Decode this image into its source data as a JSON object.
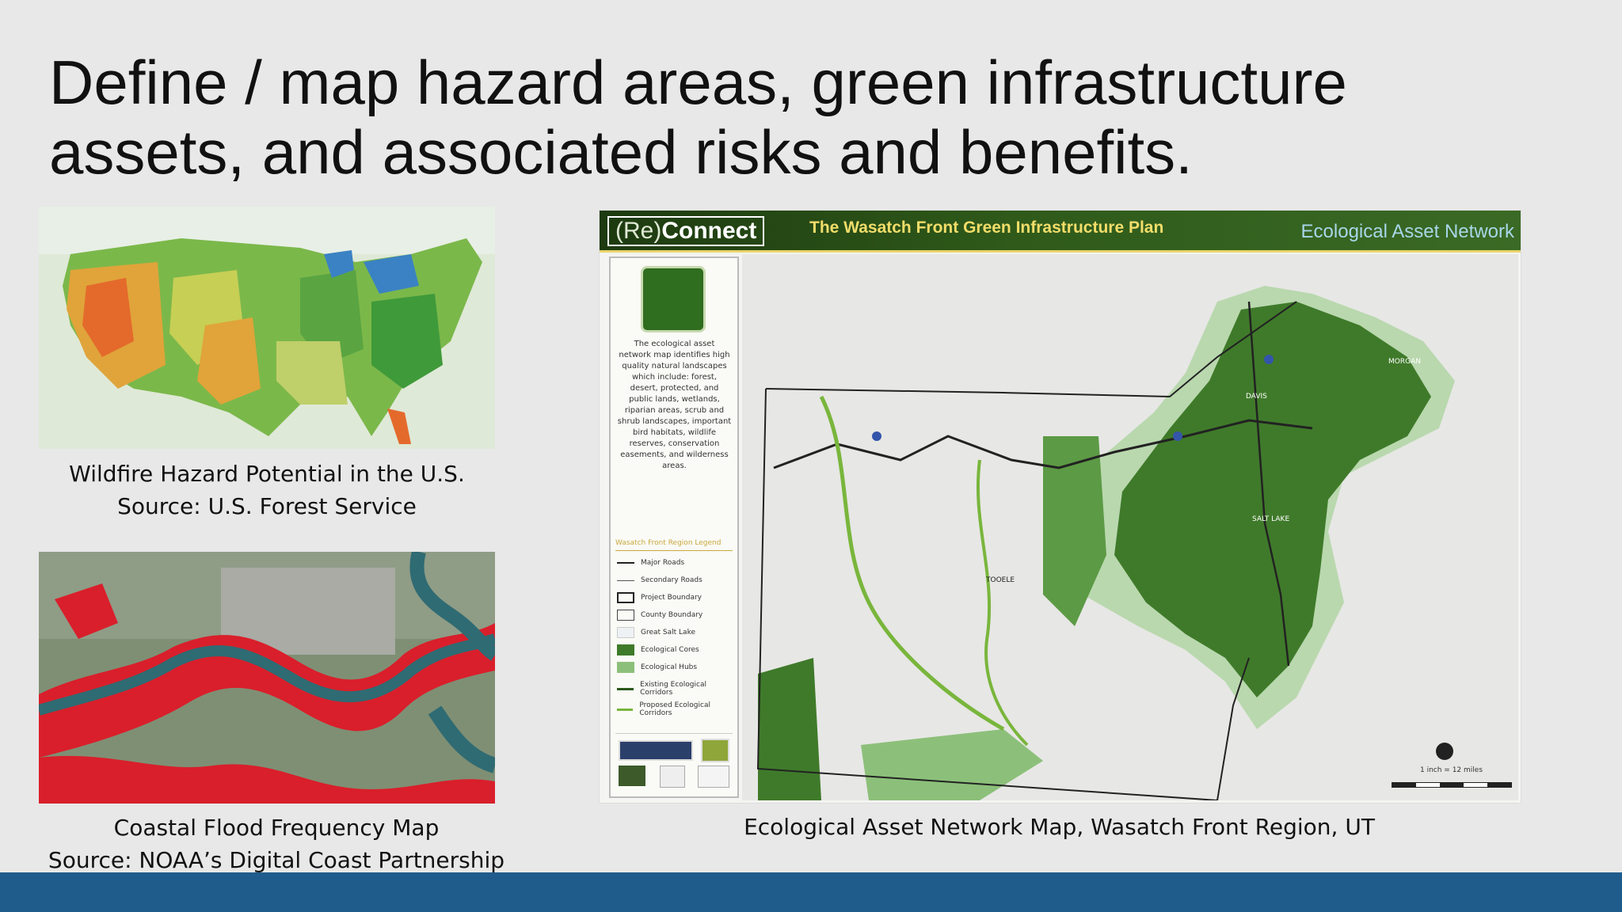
{
  "slide": {
    "title": "Define / map hazard areas, green infrastructure assets, and associated risks and benefits."
  },
  "figures": {
    "wildfire": {
      "caption_line1": "Wildfire Hazard Potential in the U.S.",
      "caption_line2": "Source: U.S. Forest Service"
    },
    "coastal": {
      "caption_line1": "Coastal Flood Frequency Map",
      "caption_line2": "Source: NOAA’s Digital Coast Partnership"
    },
    "ecological": {
      "caption": "Ecological Asset Network Map, Wasatch Front Region, UT",
      "brand_re": "(Re)",
      "brand_connect": "Connect",
      "plan_title": "The Wasatch Front Green Infrastructure Plan",
      "map_label": "Ecological Asset Network",
      "description": "The ecological asset network map identifies high quality natural landscapes which include: forest, desert, protected, and public lands, wetlands, riparian areas, scrub and shrub landscapes, important bird habitats, wildlife reserves, conservation easements, and wilderness areas.",
      "legend_title": "Wasatch Front Region Legend",
      "legend": [
        "Major Roads",
        "Secondary Roads",
        "Project Boundary",
        "County Boundary",
        "Great Salt Lake",
        "Ecological Cores",
        "Ecological Hubs",
        "Existing Ecological Corridors",
        "Proposed Ecological Corridors"
      ],
      "place_tooele": "TOOELE",
      "place_salt_lake": "SALT LAKE",
      "place_davis": "DAVIS",
      "place_morgan": "MORGAN",
      "scale_text": "1 inch = 12 miles",
      "colors": {
        "core": "#3f7a2a",
        "hub": "#8cc07a",
        "header": "#2f5a1a",
        "accent": "#e9d46a"
      }
    }
  },
  "theme": {
    "bottom_bar": "#1f5c8c",
    "background": "#e8e8e8"
  }
}
